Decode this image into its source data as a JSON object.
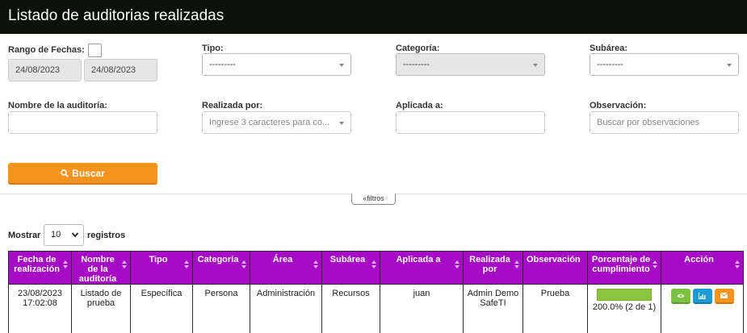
{
  "header": {
    "title": "Listado de auditorias realizadas"
  },
  "filters": {
    "rango_label": "Rango de Fechas:",
    "fecha_desde": "24/08/2023",
    "fecha_hasta": "24/08/2023",
    "tipo_label": "Tipo:",
    "tipo_value": "---------",
    "categoria_label": "Categoría:",
    "categoria_value": "---------",
    "subarea_label": "Subárea:",
    "subarea_value": "---------",
    "nombre_label": "Nombre de la auditoría:",
    "nombre_value": "",
    "realizada_label": "Realizada por:",
    "realizada_placeholder": "Ingrese 3 caracteres para co...",
    "aplicada_label": "Aplicada a:",
    "aplicada_value": "",
    "observacion_label": "Observación:",
    "observacion_placeholder": "Buscar por observaciones",
    "buscar_label": "Buscar",
    "filtros_toggle": "filtros"
  },
  "length": {
    "mostrar": "Mostrar",
    "value": "10",
    "registros": "registros"
  },
  "table": {
    "headers": {
      "fecha": "Fecha de realización",
      "nombre": "Nombre de la auditoría",
      "tipo": "Tipo",
      "categoria": "Categoría",
      "area": "Área",
      "subarea": "Subárea",
      "aplicada": "Aplicada a",
      "realizada": "Realizada por",
      "observacion": "Observación",
      "porcentaje": "Porcentaje de cumplimiento",
      "accion": "Acción"
    },
    "rows": [
      {
        "fecha": "23/08/2023 17:02:08",
        "nombre": "Listado de prueba",
        "tipo": "Específica",
        "categoria": "Persona",
        "area": "Administración",
        "subarea": "Recursos",
        "aplicada": "juan",
        "realizada": "Admin Demo SafeTI",
        "observacion": "Prueba",
        "porcentaje_fill": 1.0,
        "porcentaje": "200.0% (2 de 1)",
        "actions": [
          "eye-icon",
          "chart-icon",
          "envelope-icon"
        ]
      }
    ]
  },
  "colors": {
    "header_bg": "#0b1309",
    "table_header_bg": "#a70ac4",
    "button_orange": "#f7941d",
    "progress_green": "#8cc63f",
    "action_green": "#7cc242",
    "action_blue": "#1e9ad6"
  }
}
